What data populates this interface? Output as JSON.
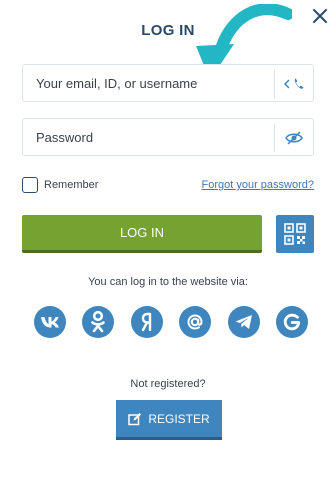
{
  "header": {
    "title": "LOG IN"
  },
  "email_field": {
    "placeholder": "Your email, ID, or username"
  },
  "password_field": {
    "placeholder": "Password"
  },
  "remember": {
    "label": "Remember"
  },
  "forgot": {
    "label": "Forgot your password?"
  },
  "login_button": {
    "label": "LOG IN"
  },
  "social": {
    "caption": "You can log in to the website via:",
    "items": [
      "vk-icon",
      "odnoklassniki-icon",
      "yandex-icon",
      "mail-at-icon",
      "telegram-icon",
      "google-icon"
    ]
  },
  "register": {
    "prompt": "Not registered?",
    "button_label": "REGISTER"
  },
  "colors": {
    "primary_blue": "#3e86bd",
    "login_green": "#76a230",
    "title_navy": "#2b4a6b",
    "link_blue": "#3a78b9",
    "arrow_teal": "#23b7c5"
  }
}
